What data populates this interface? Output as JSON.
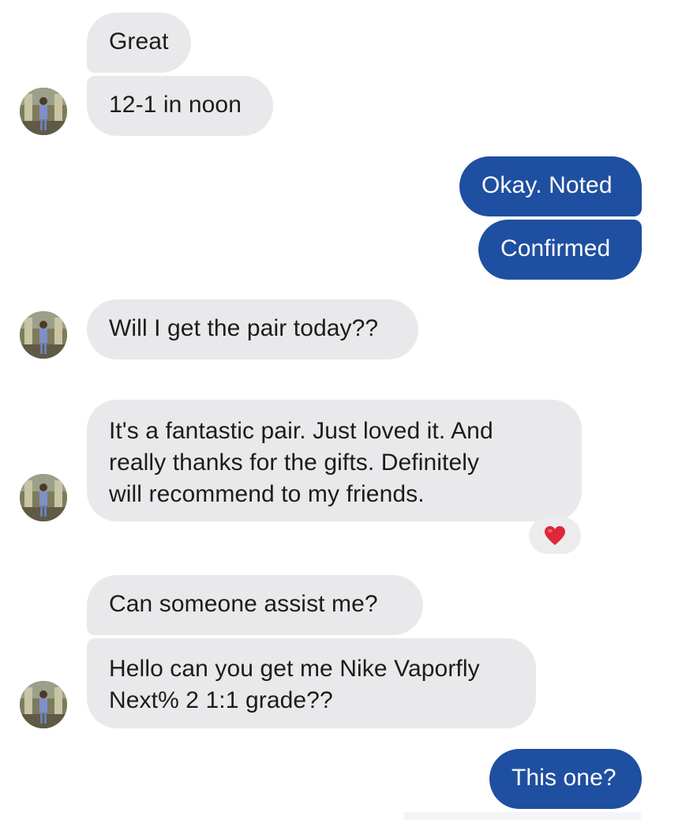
{
  "conversation": {
    "messages": [
      {
        "sender": "contact",
        "text": "Great"
      },
      {
        "sender": "contact",
        "text": "12-1 in noon"
      },
      {
        "sender": "me",
        "text": "Okay. Noted"
      },
      {
        "sender": "me",
        "text": "Confirmed"
      },
      {
        "sender": "contact",
        "text": "Will I get the pair today??"
      },
      {
        "sender": "contact",
        "lines": [
          "It's a fantastic pair. Just loved it. And",
          "really thanks for the gifts. Definitely",
          "will recommend to my friends."
        ],
        "reaction": "❤️"
      },
      {
        "sender": "contact",
        "text": "Can someone assist me?"
      },
      {
        "sender": "contact",
        "lines": [
          "Hello can you get me Nike Vaporfly",
          "Next% 2 1:1 grade??"
        ]
      },
      {
        "sender": "me",
        "text": "This one?"
      }
    ]
  },
  "colors": {
    "incoming_bubble": "#e9e9eb",
    "outgoing_bubble": "#1f4fa0",
    "reaction_heart": "#e0273a"
  },
  "icons": {
    "avatar": "contact-avatar-photo",
    "reaction": "red-heart"
  }
}
